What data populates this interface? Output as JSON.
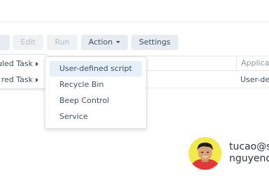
{
  "toolbar": {
    "edit": "Edit",
    "run": "Run",
    "action": "Action",
    "settings": "Settings"
  },
  "grid": {
    "col_application": "Applicat",
    "row_application": "User-de"
  },
  "create_menu": {
    "items": [
      {
        "label": "uled Task"
      },
      {
        "label": "red Task"
      }
    ]
  },
  "submenu": {
    "items": [
      {
        "label": "User-defined script",
        "highlighted": true
      },
      {
        "label": "Recycle Bin"
      },
      {
        "label": "Beep Control"
      },
      {
        "label": "Service"
      }
    ]
  },
  "user": {
    "line1": "tucao@s",
    "line2": "nguyeno",
    "avatar_bg": "#f3e94a"
  },
  "colors": {
    "button_bg": "#e6ecf1",
    "highlight": "#e5f0fb",
    "text": "#3f4f5f"
  }
}
